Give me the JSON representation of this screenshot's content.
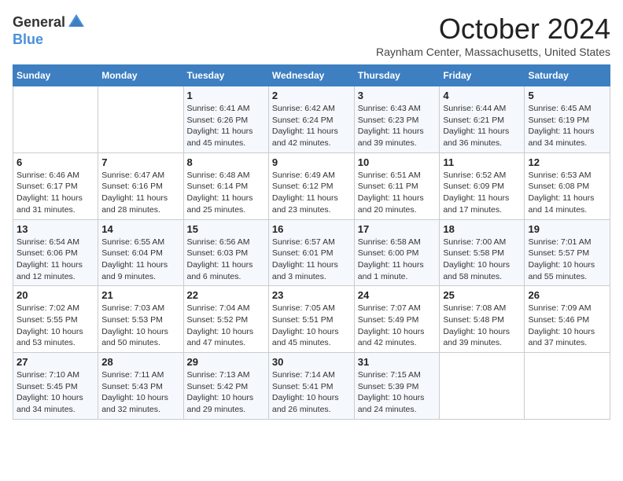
{
  "header": {
    "logo_general": "General",
    "logo_blue": "Blue",
    "month_title": "October 2024",
    "location": "Raynham Center, Massachusetts, United States"
  },
  "days_of_week": [
    "Sunday",
    "Monday",
    "Tuesday",
    "Wednesday",
    "Thursday",
    "Friday",
    "Saturday"
  ],
  "weeks": [
    [
      {
        "day": "",
        "info": ""
      },
      {
        "day": "",
        "info": ""
      },
      {
        "day": "1",
        "info": "Sunrise: 6:41 AM\nSunset: 6:26 PM\nDaylight: 11 hours and 45 minutes."
      },
      {
        "day": "2",
        "info": "Sunrise: 6:42 AM\nSunset: 6:24 PM\nDaylight: 11 hours and 42 minutes."
      },
      {
        "day": "3",
        "info": "Sunrise: 6:43 AM\nSunset: 6:23 PM\nDaylight: 11 hours and 39 minutes."
      },
      {
        "day": "4",
        "info": "Sunrise: 6:44 AM\nSunset: 6:21 PM\nDaylight: 11 hours and 36 minutes."
      },
      {
        "day": "5",
        "info": "Sunrise: 6:45 AM\nSunset: 6:19 PM\nDaylight: 11 hours and 34 minutes."
      }
    ],
    [
      {
        "day": "6",
        "info": "Sunrise: 6:46 AM\nSunset: 6:17 PM\nDaylight: 11 hours and 31 minutes."
      },
      {
        "day": "7",
        "info": "Sunrise: 6:47 AM\nSunset: 6:16 PM\nDaylight: 11 hours and 28 minutes."
      },
      {
        "day": "8",
        "info": "Sunrise: 6:48 AM\nSunset: 6:14 PM\nDaylight: 11 hours and 25 minutes."
      },
      {
        "day": "9",
        "info": "Sunrise: 6:49 AM\nSunset: 6:12 PM\nDaylight: 11 hours and 23 minutes."
      },
      {
        "day": "10",
        "info": "Sunrise: 6:51 AM\nSunset: 6:11 PM\nDaylight: 11 hours and 20 minutes."
      },
      {
        "day": "11",
        "info": "Sunrise: 6:52 AM\nSunset: 6:09 PM\nDaylight: 11 hours and 17 minutes."
      },
      {
        "day": "12",
        "info": "Sunrise: 6:53 AM\nSunset: 6:08 PM\nDaylight: 11 hours and 14 minutes."
      }
    ],
    [
      {
        "day": "13",
        "info": "Sunrise: 6:54 AM\nSunset: 6:06 PM\nDaylight: 11 hours and 12 minutes."
      },
      {
        "day": "14",
        "info": "Sunrise: 6:55 AM\nSunset: 6:04 PM\nDaylight: 11 hours and 9 minutes."
      },
      {
        "day": "15",
        "info": "Sunrise: 6:56 AM\nSunset: 6:03 PM\nDaylight: 11 hours and 6 minutes."
      },
      {
        "day": "16",
        "info": "Sunrise: 6:57 AM\nSunset: 6:01 PM\nDaylight: 11 hours and 3 minutes."
      },
      {
        "day": "17",
        "info": "Sunrise: 6:58 AM\nSunset: 6:00 PM\nDaylight: 11 hours and 1 minute."
      },
      {
        "day": "18",
        "info": "Sunrise: 7:00 AM\nSunset: 5:58 PM\nDaylight: 10 hours and 58 minutes."
      },
      {
        "day": "19",
        "info": "Sunrise: 7:01 AM\nSunset: 5:57 PM\nDaylight: 10 hours and 55 minutes."
      }
    ],
    [
      {
        "day": "20",
        "info": "Sunrise: 7:02 AM\nSunset: 5:55 PM\nDaylight: 10 hours and 53 minutes."
      },
      {
        "day": "21",
        "info": "Sunrise: 7:03 AM\nSunset: 5:53 PM\nDaylight: 10 hours and 50 minutes."
      },
      {
        "day": "22",
        "info": "Sunrise: 7:04 AM\nSunset: 5:52 PM\nDaylight: 10 hours and 47 minutes."
      },
      {
        "day": "23",
        "info": "Sunrise: 7:05 AM\nSunset: 5:51 PM\nDaylight: 10 hours and 45 minutes."
      },
      {
        "day": "24",
        "info": "Sunrise: 7:07 AM\nSunset: 5:49 PM\nDaylight: 10 hours and 42 minutes."
      },
      {
        "day": "25",
        "info": "Sunrise: 7:08 AM\nSunset: 5:48 PM\nDaylight: 10 hours and 39 minutes."
      },
      {
        "day": "26",
        "info": "Sunrise: 7:09 AM\nSunset: 5:46 PM\nDaylight: 10 hours and 37 minutes."
      }
    ],
    [
      {
        "day": "27",
        "info": "Sunrise: 7:10 AM\nSunset: 5:45 PM\nDaylight: 10 hours and 34 minutes."
      },
      {
        "day": "28",
        "info": "Sunrise: 7:11 AM\nSunset: 5:43 PM\nDaylight: 10 hours and 32 minutes."
      },
      {
        "day": "29",
        "info": "Sunrise: 7:13 AM\nSunset: 5:42 PM\nDaylight: 10 hours and 29 minutes."
      },
      {
        "day": "30",
        "info": "Sunrise: 7:14 AM\nSunset: 5:41 PM\nDaylight: 10 hours and 26 minutes."
      },
      {
        "day": "31",
        "info": "Sunrise: 7:15 AM\nSunset: 5:39 PM\nDaylight: 10 hours and 24 minutes."
      },
      {
        "day": "",
        "info": ""
      },
      {
        "day": "",
        "info": ""
      }
    ]
  ]
}
